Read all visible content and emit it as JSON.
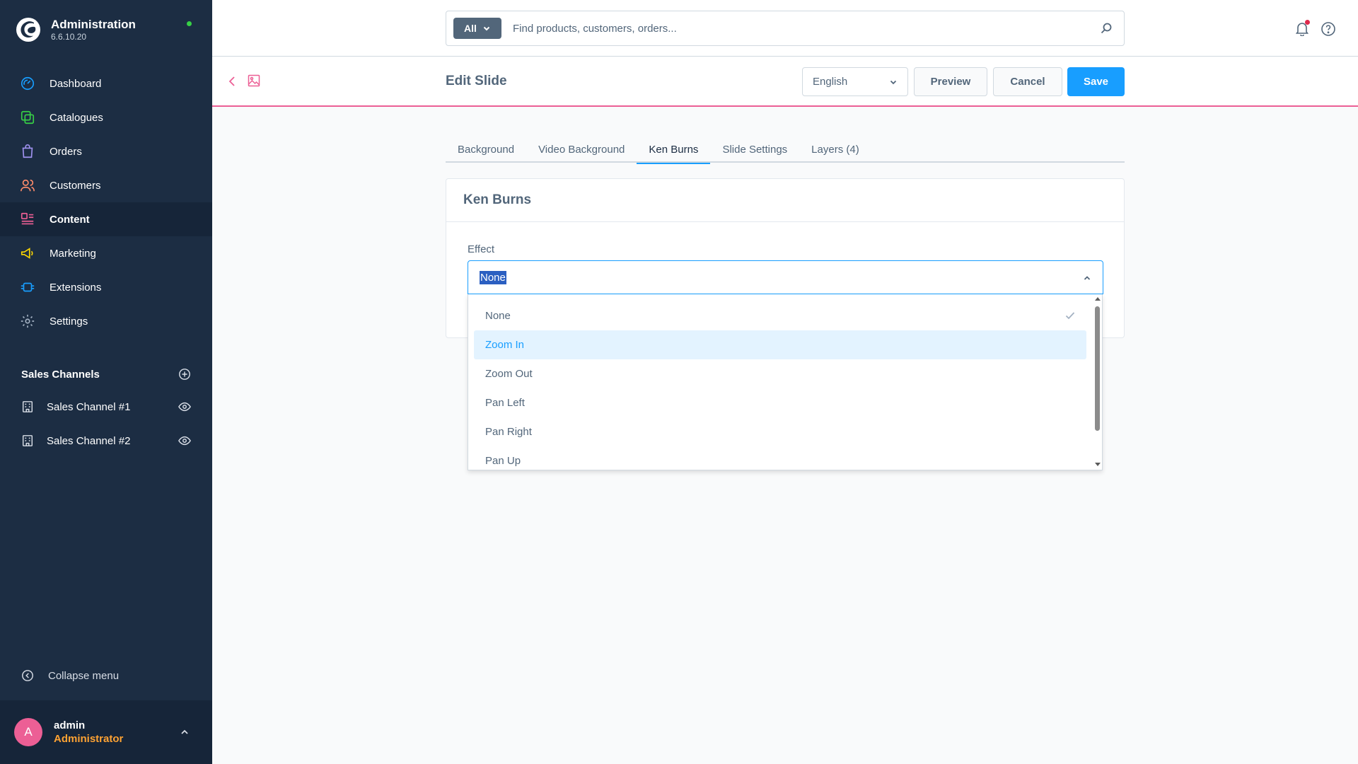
{
  "app": {
    "title": "Administration",
    "version": "6.6.10.20"
  },
  "sidebar": {
    "items": [
      {
        "label": "Dashboard",
        "icon": "dashboard-icon"
      },
      {
        "label": "Catalogues",
        "icon": "catalogues-icon"
      },
      {
        "label": "Orders",
        "icon": "orders-icon"
      },
      {
        "label": "Customers",
        "icon": "customers-icon"
      },
      {
        "label": "Content",
        "icon": "content-icon",
        "active": true
      },
      {
        "label": "Marketing",
        "icon": "marketing-icon"
      },
      {
        "label": "Extensions",
        "icon": "extensions-icon"
      },
      {
        "label": "Settings",
        "icon": "settings-icon"
      }
    ],
    "sales_channels_title": "Sales Channels",
    "sales_channels": [
      {
        "label": "Sales Channel #1"
      },
      {
        "label": "Sales Channel #2"
      }
    ],
    "collapse_label": "Collapse menu",
    "user": {
      "initial": "A",
      "name": "admin",
      "role": "Administrator"
    }
  },
  "search": {
    "type_label": "All",
    "placeholder": "Find products, customers, orders..."
  },
  "smartbar": {
    "title": "Edit Slide",
    "language": "English",
    "preview_label": "Preview",
    "cancel_label": "Cancel",
    "save_label": "Save"
  },
  "tabs": [
    {
      "label": "Background"
    },
    {
      "label": "Video Background"
    },
    {
      "label": "Ken Burns",
      "active": true
    },
    {
      "label": "Slide Settings"
    },
    {
      "label": "Layers (4)"
    }
  ],
  "card": {
    "title": "Ken Burns",
    "field_label": "Effect",
    "selected_value": "None"
  },
  "dropdown": {
    "options": [
      {
        "label": "None",
        "selected": true
      },
      {
        "label": "Zoom In",
        "hover": true
      },
      {
        "label": "Zoom Out"
      },
      {
        "label": "Pan Left"
      },
      {
        "label": "Pan Right"
      },
      {
        "label": "Pan Up"
      }
    ]
  },
  "colors": {
    "sidebar_bg": "#1c2d43",
    "accent": "#189eff",
    "brand_pink": "#ec5f95",
    "role_orange": "#ffa333",
    "status_green": "#37d046"
  }
}
